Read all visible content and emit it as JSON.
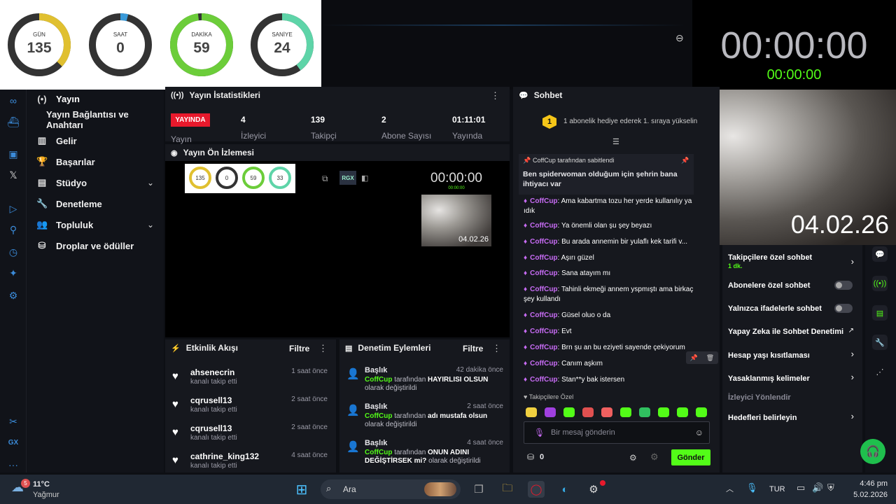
{
  "countdown": [
    {
      "label": "GÜN",
      "value": "135",
      "fraction": 0.37,
      "color": "#e0c030"
    },
    {
      "label": "SAAT",
      "value": "0",
      "fraction": 0.04,
      "color": "#3a9ad9"
    },
    {
      "label": "DAKİKA",
      "value": "59",
      "fraction": 0.98,
      "color": "#6ccd3a"
    },
    {
      "label": "SANİYE",
      "value": "24",
      "fraction": 0.4,
      "color": "#5ed4a8"
    }
  ],
  "timer": {
    "big": "00:00:00",
    "small": "00:00:00"
  },
  "webcam": {
    "date": "04.02.26"
  },
  "nav": {
    "items": [
      {
        "label": "Yayın",
        "icon": "broadcast-icon"
      },
      {
        "label": "Yayın Bağlantısı ve Anahtarı"
      },
      {
        "label": "Gelir",
        "icon": "chart-icon"
      },
      {
        "label": "Başarılar",
        "icon": "trophy-icon"
      },
      {
        "label": "Stüdyo",
        "icon": "studio-icon"
      },
      {
        "label": "Denetleme",
        "icon": "wrench-icon"
      },
      {
        "label": "Topluluk",
        "icon": "users-icon"
      },
      {
        "label": "Droplar ve ödüller",
        "icon": "gift-icon"
      }
    ]
  },
  "stats": {
    "title": "Yayın İstatistikleri",
    "live": "YAYINDA",
    "values": [
      {
        "value": "4",
        "label": "İzleyici"
      },
      {
        "value": "139",
        "label": "Takipçi"
      },
      {
        "value": "2",
        "label": "Abone Sayısı"
      },
      {
        "value": "01:11:01",
        "label": "Yayında"
      }
    ],
    "first_label": "Yayın"
  },
  "preview": {
    "title": "Yayın Ön İzlemesi",
    "mini_values": [
      "135",
      "0",
      "59",
      "33"
    ],
    "timer": "00:00:00",
    "timer_small": "00:00:00",
    "date": "04.02.26",
    "rgx": "RGX"
  },
  "activity": {
    "title": "Etkinlik Akışı",
    "filter": "Filtre",
    "items": [
      {
        "name": "ahsenecrin",
        "sub": "kanalı takip etti",
        "time": "1 saat önce"
      },
      {
        "name": "cqrusell13",
        "sub": "kanalı takip etti",
        "time": "2 saat önce"
      },
      {
        "name": "cqrusell13",
        "sub": "kanalı takip etti",
        "time": "2 saat önce"
      },
      {
        "name": "cathrine_king132",
        "sub": "kanalı takip etti",
        "time": "4 saat önce"
      }
    ]
  },
  "moderation": {
    "title": "Denetim Eylemleri",
    "filter": "Filtre",
    "items": [
      {
        "title": "Başlık",
        "time": "42 dakika önce",
        "user": "CoffCup",
        "mid": " tarafından ",
        "value": "HAYIRLISI OLSUN",
        "tail": " olarak değiştirildi"
      },
      {
        "title": "Başlık",
        "time": "2 saat önce",
        "user": "CoffCup",
        "mid": " tarafından ",
        "value": "adı mustafa olsun",
        "tail": " olarak değiştirildi"
      },
      {
        "title": "Başlık",
        "time": "4 saat önce",
        "user": "CoffCup",
        "mid": " tarafından ",
        "value": "ONUN ADINI DEĞİŞTİRSEK mi?",
        "tail": " olarak değiştirildi"
      }
    ]
  },
  "chat": {
    "title": "Sohbet",
    "gift_badge": "1",
    "gift_text": "1 abonelik hediye ederek 1. sıraya yükselin",
    "pinned_by": "CoffCup tarafından sabitlendi",
    "pinned_text": "Ben spiderwoman olduğum için şehrin bana ihtiyacı var",
    "messages": [
      {
        "user": "CoffCup",
        "text": "Ama kabartma tozu her yerde kullanılıy ya ıdık"
      },
      {
        "user": "CoffCup",
        "text": "Ya önemli olan şu şey beyazı"
      },
      {
        "user": "CoffCup",
        "text": "Bu arada annemin bir yulaflı kek tarifi v..."
      },
      {
        "user": "CoffCup",
        "text": "Aşırı güzel"
      },
      {
        "user": "CoffCup",
        "text": "Sana atayım mı"
      },
      {
        "user": "CoffCup",
        "text": "Tahinli ekmeği annem yspmıştı ama birkaç şey kullandı"
      },
      {
        "user": "CoffCup",
        "text": "Güsel oluo o da"
      },
      {
        "user": "CoffCup",
        "text": "Evt"
      },
      {
        "user": "CoffCup",
        "text": "Brn şu an bu eziyeti sayende çekiyorum"
      },
      {
        "user": "CoffCup",
        "text": "Canım aşkım"
      },
      {
        "user": "CoffCup",
        "text": "Stan**y bak istersen"
      }
    ],
    "followers_only": "Takipçilere Özel",
    "placeholder": "Bir mesaj gönderin",
    "points": "0",
    "send": "Gönder"
  },
  "settings": {
    "items": [
      {
        "label": "Takipçilere özel sohbet",
        "sub": "1 dk.",
        "control": "arrow"
      },
      {
        "label": "Abonelere özel sohbet",
        "control": "toggle"
      },
      {
        "label": "Yalnızca ifadelerle sohbet",
        "control": "toggle"
      },
      {
        "label": "Yapay Zeka ile Sohbet Denetimi",
        "control": "external"
      },
      {
        "label": "Hesap yaşı kısıtlaması",
        "control": "arrow"
      },
      {
        "label": "Yasaklanmış kelimeler",
        "control": "arrow"
      },
      {
        "label": "İzleyici Yönlendir",
        "control": "none"
      },
      {
        "label": "Hedefleri belirleyin",
        "control": "arrow"
      }
    ]
  },
  "taskbar": {
    "weather_temp": "11°C",
    "weather_desc": "Yağmur",
    "weather_badge": "5",
    "search": "Ara",
    "lang": "TUR",
    "time": "4:46 pm",
    "date": "5.02.2026"
  },
  "colors": {
    "accent": "#53fc18",
    "live": "#e8192c",
    "chat_user": "#c86cf5"
  }
}
